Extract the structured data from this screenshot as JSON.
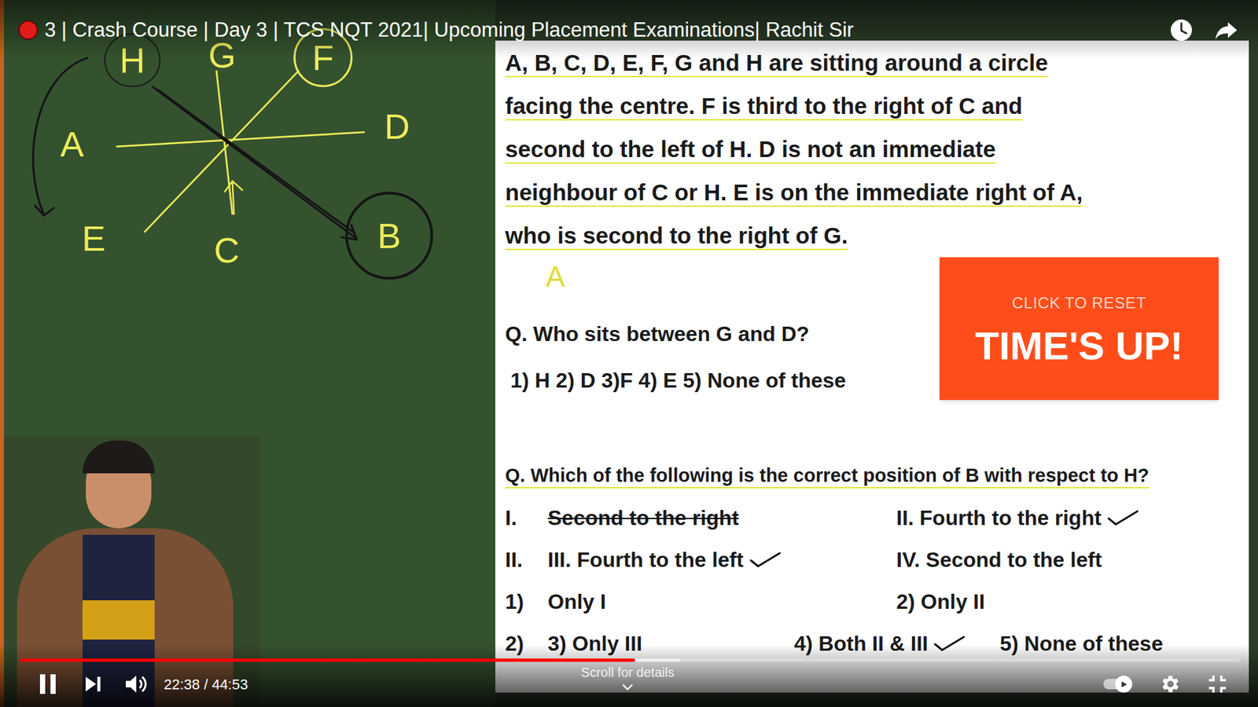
{
  "player": {
    "title": "3 | Crash Course | Day 3 | TCS NQT 2021| Upcoming Placement Examinations| Rachit Sir",
    "playing": true,
    "progress": {
      "level": 0.504
    },
    "buffered": {
      "level": 0.541
    },
    "time": "22:38 / 44:53",
    "scroll_hint": "Scroll for details",
    "autoplay": {
      "on": true
    }
  },
  "board": {
    "letters": [
      {
        "text": "H",
        "circled": true
      },
      {
        "text": "G",
        "circled": false
      },
      {
        "text": "F",
        "circled": true
      },
      {
        "text": "A",
        "circled": false
      },
      {
        "text": "D",
        "circled": false
      },
      {
        "text": "E",
        "circled": false
      },
      {
        "text": "C",
        "circled": false
      },
      {
        "text": "B",
        "circled": true
      }
    ]
  },
  "slide": {
    "paragraph": [
      "A, B, C, D, E, F, G and H are sitting around a circle",
      "facing the centre. F is third to the right of C and",
      "second to the left of H. D is not an immediate",
      "neighbour of C or H. E is on the immediate right of A,",
      "who is second to the right of G."
    ],
    "annotation": "A",
    "q1": {
      "question": "Q. Who sits between G and D?",
      "options": "1) H 2) D 3)F 4) E 5) None of these"
    },
    "timer": {
      "hint": "CLICK TO RESET",
      "label": "TIME'S UP!"
    },
    "q2": {
      "question": "Q. Which of the following is the correct position of B with respect to H?",
      "rows": [
        {
          "cells": [
            {
              "text": "I.",
              "struck": false,
              "ticked": false
            },
            {
              "text": "Second to the right",
              "struck": true,
              "ticked": false
            },
            {
              "text": "II. Fourth to the right",
              "struck": false,
              "ticked": true
            }
          ]
        },
        {
          "cells": [
            {
              "text": "II.",
              "struck": false,
              "ticked": false
            },
            {
              "text": "III. Fourth to the left",
              "struck": false,
              "ticked": true
            },
            {
              "text": "IV. Second to the left",
              "struck": false,
              "ticked": false
            }
          ]
        },
        {
          "cells": [
            {
              "text": "1)",
              "struck": false,
              "ticked": false
            },
            {
              "text": "Only I",
              "struck": false,
              "ticked": false
            },
            {
              "text": "2) Only II",
              "struck": false,
              "ticked": false
            }
          ]
        },
        {
          "cells": [
            {
              "text": "2)",
              "struck": false,
              "ticked": false
            },
            {
              "text": "3) Only III",
              "struck": false,
              "ticked": false
            },
            {
              "text": "4) Both II & III",
              "struck": false,
              "ticked": true
            },
            {
              "text": "5) None of these",
              "struck": false,
              "ticked": false
            }
          ]
        }
      ]
    }
  }
}
